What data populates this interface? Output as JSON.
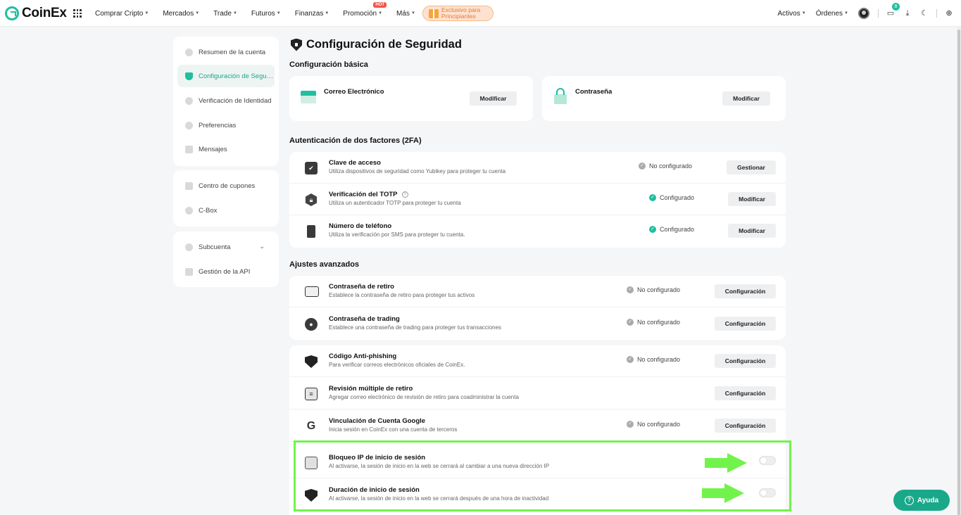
{
  "brand": {
    "name": "CoinEx",
    "accent": "#1fbf9f"
  },
  "nav": {
    "items": [
      {
        "label": "Comprar Cripto"
      },
      {
        "label": "Mercados"
      },
      {
        "label": "Trade"
      },
      {
        "label": "Futuros"
      },
      {
        "label": "Finanzas"
      },
      {
        "label": "Promoción",
        "badge": "HOT"
      },
      {
        "label": "Más"
      }
    ],
    "promo_line1": "Exclusivo para",
    "promo_line2": "Principiantes",
    "activos": "Activos",
    "ordenes": "Órdenes",
    "notif_count": "8"
  },
  "sidebar": {
    "group1": [
      {
        "label": "Resumen de la cuenta",
        "icon": "pie-chart-icon"
      },
      {
        "label": "Configuración de Seguridad",
        "icon": "shield-icon",
        "active": true
      },
      {
        "label": "Verificación de Identidad",
        "icon": "id-icon"
      },
      {
        "label": "Preferencias",
        "icon": "gear-icon"
      },
      {
        "label": "Mensajes",
        "icon": "message-icon"
      }
    ],
    "group2": [
      {
        "label": "Centro de cupones",
        "icon": "coupon-icon"
      },
      {
        "label": "C-Box",
        "icon": "gift-box-icon"
      }
    ],
    "group3": [
      {
        "label": "Subcuenta",
        "icon": "subaccount-icon"
      },
      {
        "label": "Gestión de la API",
        "icon": "api-icon"
      }
    ]
  },
  "page": {
    "title": "Configuración de Seguridad",
    "basic_title": "Configuración básica",
    "twofa_title": "Autenticación de dos factores (2FA)",
    "advanced_title": "Ajustes avanzados"
  },
  "basic": {
    "email": {
      "label": "Correo Electrónico",
      "button": "Modificar"
    },
    "password": {
      "label": "Contraseña",
      "button": "Modificar"
    }
  },
  "twofa": [
    {
      "title": "Clave de acceso",
      "desc": "Utiliza dispositivos de seguridad como Yubikey para proteger tu cuenta",
      "status": "No configurado",
      "button": "Gestionar"
    },
    {
      "title": "Verificación del TOTP",
      "desc": "Utiliza un autenticador TOTP para proteger tu cuenta",
      "status": "Configurado",
      "button": "Modificar"
    },
    {
      "title": "Número de teléfono",
      "desc": "Utiliza la verificación por SMS para proteger tu cuenta.",
      "status": "Configurado",
      "button": "Modificar"
    }
  ],
  "advanced1": [
    {
      "title": "Contraseña de retiro",
      "desc": "Establece la contraseña de retiro para proteger tus activos",
      "status": "No configurado",
      "button": "Configuración"
    },
    {
      "title": "Contraseña de trading",
      "desc": "Establece una contraseña de trading para proteger tus transacciones",
      "status": "No configurado",
      "button": "Configuración"
    }
  ],
  "advanced2": [
    {
      "title": "Código Anti-phishing",
      "desc": "Para verificar correos electrónicos oficiales de CoinEx.",
      "status": "No configurado",
      "button": "Configuración"
    },
    {
      "title": "Revisión múltiple de retiro",
      "desc": "Agregar correo electrónico de revisión de retiro para coadministrar la cuenta",
      "button": "Configuración"
    },
    {
      "title": "Vinculación de Cuenta Google",
      "desc": "Inicia sesión en CoinEx con una cuenta de terceros",
      "status": "No configurado",
      "button": "Configuración"
    },
    {
      "title": "Bloqueo IP de inicio de sesión",
      "desc": "Al activarse, la sesión de inicio en la web se cerrará al cambiar a una nueva dirección IP",
      "toggle": false
    },
    {
      "title": "Duración de inicio de sesión",
      "desc": "Al activarse, la sesión de inicio en la web se cerrará después de una hora de inactividad",
      "toggle": false
    }
  ],
  "help": {
    "label": "Ayuda"
  }
}
